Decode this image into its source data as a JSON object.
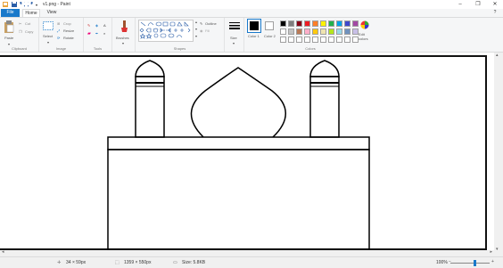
{
  "title": "v1.png - Paint",
  "tabs": {
    "file": "File",
    "home": "Home",
    "view": "View"
  },
  "clipboard": {
    "paste": "Paste",
    "cut": "Cut",
    "copy": "Copy",
    "label": "Clipboard"
  },
  "image": {
    "select": "Select",
    "crop": "Crop",
    "resize": "Resize",
    "rotate": "Rotate",
    "label": "Image"
  },
  "tools": {
    "label": "Tools"
  },
  "brushes": {
    "label": "Brushes"
  },
  "shapes": {
    "outline": "Outline",
    "fill": "Fill",
    "label": "Shapes"
  },
  "size": {
    "label": "Size"
  },
  "colors": {
    "color1": "Color 1",
    "color2": "Color 2",
    "edit": "Edit colors",
    "label": "Colors",
    "palette_row1": [
      "#000000",
      "#7f7f7f",
      "#880015",
      "#ed1c24",
      "#ff7f27",
      "#fff200",
      "#22b14c",
      "#00a2e8",
      "#3f48cc",
      "#a349a4"
    ],
    "palette_row2": [
      "#ffffff",
      "#c3c3c3",
      "#b97a57",
      "#ffaec9",
      "#ffc90e",
      "#efe4b0",
      "#b5e61d",
      "#99d9ea",
      "#7092be",
      "#c8bfe7"
    ],
    "palette_row3": [
      "#ffffff",
      "#ffffff",
      "#ffffff",
      "#ffffff",
      "#ffffff",
      "#ffffff",
      "#ffffff",
      "#ffffff",
      "#ffffff",
      "#ffffff"
    ],
    "color1_value": "#000000",
    "color2_value": "#ffffff"
  },
  "status": {
    "cursor": "34 × 59px",
    "canvas_size": "1359 × 550px",
    "file_size": "Size: 5.8KB",
    "zoom": "100%"
  }
}
